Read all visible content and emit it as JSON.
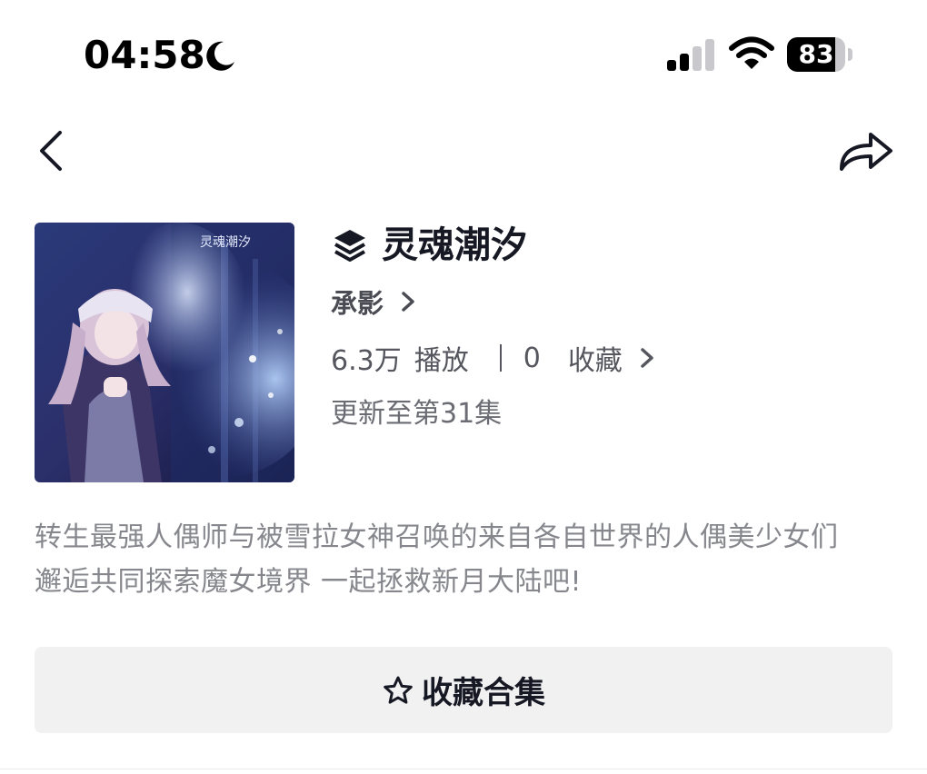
{
  "status_bar": {
    "time": "04:58",
    "battery_level": "83",
    "battery_fraction": 0.83
  },
  "nav": {
    "back_icon": "chevron-left-icon",
    "share_icon": "share-arrow-icon"
  },
  "collection": {
    "cover_caption": "灵魂潮汐",
    "title": "灵魂潮汐",
    "author": "承影",
    "plays": "6.3万",
    "plays_label": "播放",
    "favorites": "0",
    "favorites_label": "收藏",
    "update_info": "更新至第31集",
    "description_lines": [
      "转生最强人偶师与被雪拉女神召唤的来自各自世界的人偶美少女们",
      "邂逅共同探索魔女境界  一起拯救新月大陆吧!"
    ]
  },
  "actions": {
    "collect_label": "收藏合集"
  },
  "colors": {
    "text_primary": "#161823",
    "text_secondary": "#55565e",
    "text_description": "#86878d",
    "button_bg": "#f1f1f2"
  }
}
